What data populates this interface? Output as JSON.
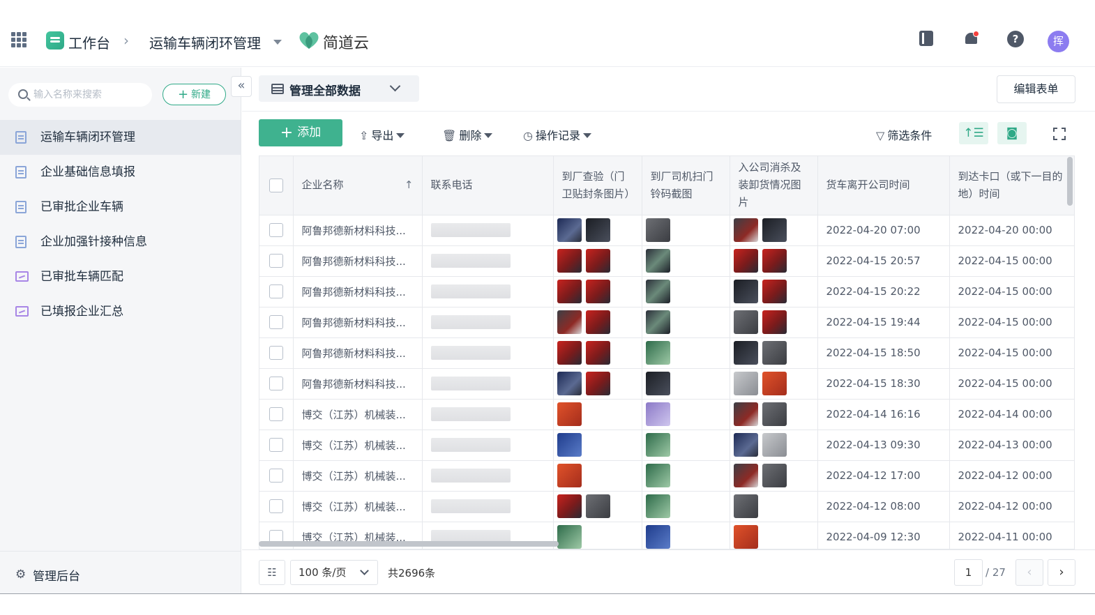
{
  "header": {
    "workspace_label": "工作台",
    "separator": "›",
    "app_name": "运输车辆闭环管理",
    "brand_name": "简道云",
    "avatar_text": "挥"
  },
  "sidebar": {
    "search_placeholder": "输入名称来搜索",
    "new_button": "新建",
    "collapse_glyph": "«",
    "items": [
      {
        "label": "运输车辆闭环管理",
        "icon": "form-icon",
        "active": true
      },
      {
        "label": "企业基础信息填报",
        "icon": "form-icon"
      },
      {
        "label": "已审批企业车辆",
        "icon": "form-icon"
      },
      {
        "label": "企业加强针接种信息",
        "icon": "form-icon"
      },
      {
        "label": "已审批车辆匹配",
        "icon": "dashboard-icon"
      },
      {
        "label": "已填报企业汇总",
        "icon": "dashboard-icon"
      }
    ],
    "admin_label": "管理后台"
  },
  "main": {
    "view_name": "管理全部数据",
    "edit_form_label": "编辑表单",
    "toolbar": {
      "add_label": "添加",
      "export_label": "导出",
      "delete_label": "删除",
      "log_label": "操作记录",
      "filter_label": "筛选条件"
    },
    "columns": {
      "company": "企业名称",
      "phone": "联系电话",
      "seal_photo": "到厂查验（门卫贴封条图片）",
      "scan_photo": "到厂司机扫门铃码截图",
      "disinfect_photo": "入公司消杀及装卸货情况图片",
      "leave_time": "货车离开公司时间",
      "arrive_time": "到达卡口（或下一目的地）时间"
    },
    "rows": [
      {
        "company": "阿鲁邦德新材料科技...",
        "leave": "2022-04-20 07:00",
        "arrive": "2022-04-20 00:00"
      },
      {
        "company": "阿鲁邦德新材料科技...",
        "leave": "2022-04-15 20:57",
        "arrive": "2022-04-15 00:00"
      },
      {
        "company": "阿鲁邦德新材料科技...",
        "leave": "2022-04-15 20:22",
        "arrive": "2022-04-15 00:00"
      },
      {
        "company": "阿鲁邦德新材料科技...",
        "leave": "2022-04-15 19:44",
        "arrive": "2022-04-15 00:00"
      },
      {
        "company": "阿鲁邦德新材料科技...",
        "leave": "2022-04-15 18:50",
        "arrive": "2022-04-15 00:00"
      },
      {
        "company": "阿鲁邦德新材料科技...",
        "leave": "2022-04-15 18:30",
        "arrive": "2022-04-15 00:00"
      },
      {
        "company": "博交（江苏）机械装...",
        "leave": "2022-04-14 16:16",
        "arrive": "2022-04-14 00:00"
      },
      {
        "company": "博交（江苏）机械装...",
        "leave": "2022-04-13 09:30",
        "arrive": "2022-04-13 00:00"
      },
      {
        "company": "博交（江苏）机械装...",
        "leave": "2022-04-12 17:00",
        "arrive": "2022-04-12 00:00"
      },
      {
        "company": "博交（江苏）机械装...",
        "leave": "2022-04-12 08:00",
        "arrive": "2022-04-12 00:00"
      },
      {
        "company": "博交（江苏）机械装...",
        "leave": "2022-04-09 12:30",
        "arrive": "2022-04-11 00:00"
      }
    ],
    "footer": {
      "per_page": "100 条/页",
      "total": "共2696条",
      "current_page": "1",
      "total_pages": "/ 27",
      "prev": "‹",
      "next": "›"
    }
  },
  "colors": {
    "accent": "#3fb28f",
    "sidebar_bg": "#f5f6f8",
    "active_item_bg": "#e7eaef"
  }
}
